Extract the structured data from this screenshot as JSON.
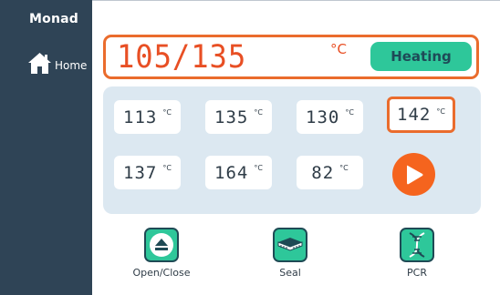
{
  "sidebar": {
    "brand": "Monad",
    "home_label": "Home"
  },
  "display": {
    "temperature": "105/135",
    "unit": "°C",
    "status": "Heating"
  },
  "cells": [
    {
      "value": "113",
      "unit": "°C",
      "selected": false
    },
    {
      "value": "135",
      "unit": "°C",
      "selected": false
    },
    {
      "value": "130",
      "unit": "°C",
      "selected": false
    },
    {
      "value": "142",
      "unit": "°C",
      "selected": true
    },
    {
      "value": "137",
      "unit": "°C",
      "selected": false
    },
    {
      "value": "164",
      "unit": "°C",
      "selected": false
    },
    {
      "value": "82",
      "unit": "°C",
      "selected": false
    }
  ],
  "actions": {
    "open_close": "Open/Close",
    "seal": "Seal",
    "pcr": "PCR"
  },
  "colors": {
    "sidebar": "#2f4456",
    "accent_orange": "#ea6c2d",
    "temp_red": "#e84f24",
    "status_green": "#2ec79a",
    "panel_bg": "#dce8f1"
  },
  "icons": {
    "home": "home-icon",
    "play": "play-icon",
    "eject": "eject-icon",
    "seal": "seal-plate-icon",
    "pcr": "dna-icon"
  }
}
